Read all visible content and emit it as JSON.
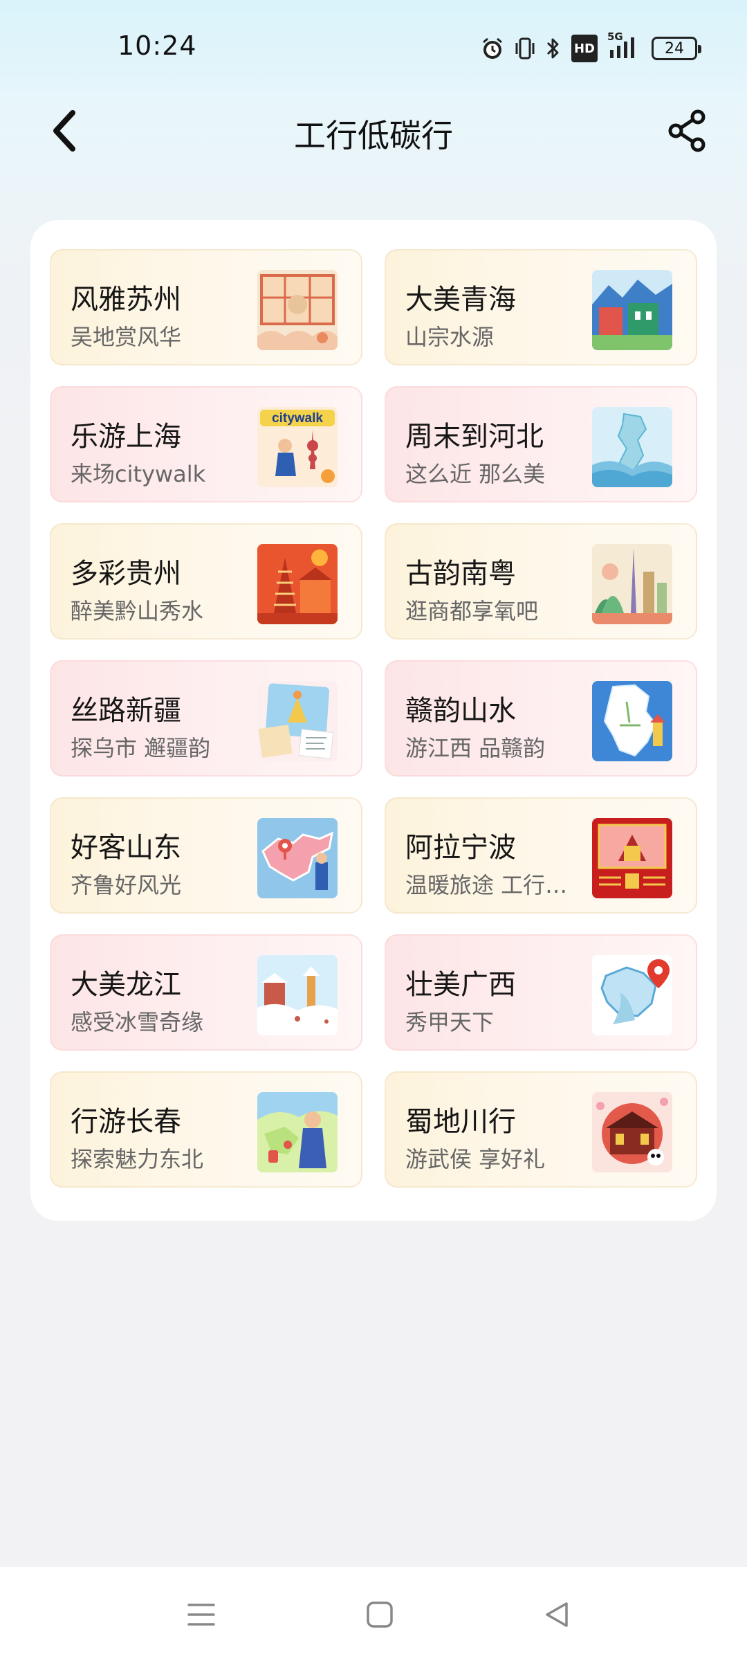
{
  "status": {
    "time": "10:24",
    "network": "5G",
    "hd": "HD",
    "battery": "24"
  },
  "header": {
    "title": "工行低碳行"
  },
  "cards": [
    {
      "title": "风雅苏州",
      "subtitle": "吴地赏风华",
      "icon": "suzhou-illustration"
    },
    {
      "title": "大美青海",
      "subtitle": "山宗水源",
      "icon": "qinghai-illustration"
    },
    {
      "title": "乐游上海",
      "subtitle": "来场citywalk",
      "icon": "shanghai-citywalk-illustration",
      "image_text": "citywalk"
    },
    {
      "title": "周末到河北",
      "subtitle": "这么近 那么美",
      "icon": "hebei-map-illustration"
    },
    {
      "title": "多彩贵州",
      "subtitle": "醉美黔山秀水",
      "icon": "guizhou-illustration"
    },
    {
      "title": "古韵南粤",
      "subtitle": "逛商都享氧吧",
      "icon": "guangdong-illustration"
    },
    {
      "title": "丝路新疆",
      "subtitle": "探乌市 邂疆韵",
      "icon": "xinjiang-illustration"
    },
    {
      "title": "赣韵山水",
      "subtitle": "游江西 品赣韵",
      "icon": "jiangxi-map-illustration"
    },
    {
      "title": "好客山东",
      "subtitle": "齐鲁好风光",
      "icon": "shandong-map-illustration"
    },
    {
      "title": "阿拉宁波",
      "subtitle": "温暖旅途 工行…",
      "icon": "ningbo-illustration"
    },
    {
      "title": "大美龙江",
      "subtitle": "感受冰雪奇缘",
      "icon": "heilongjiang-snow-illustration"
    },
    {
      "title": "壮美广西",
      "subtitle": "秀甲天下",
      "icon": "guangxi-map-illustration"
    },
    {
      "title": "行游长春",
      "subtitle": "探索魅力东北",
      "icon": "changchun-illustration"
    },
    {
      "title": "蜀地川行",
      "subtitle": "游武侯 享好礼",
      "icon": "sichuan-illustration"
    }
  ],
  "colors": {
    "card_yellow": "#fdf3dc",
    "card_pink": "#fde5e6",
    "panel": "#ffffff",
    "header_bg": "#d9f3fa"
  }
}
